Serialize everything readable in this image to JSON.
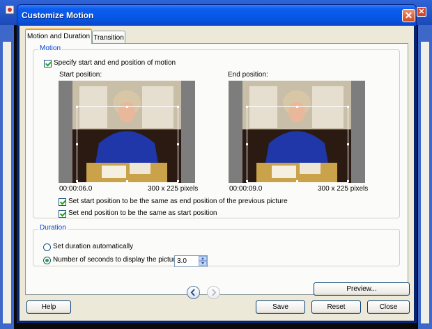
{
  "dialog": {
    "title": "Customize Motion",
    "close_glyph": "✕"
  },
  "tabs": [
    {
      "label": "Motion and Duration",
      "selected": true
    },
    {
      "label": "Transition",
      "selected": false
    }
  ],
  "motion": {
    "group_label": "Motion",
    "specify_checkbox": {
      "label": "Specify start and end position of motion",
      "checked": true
    },
    "start": {
      "label": "Start position:",
      "time": "00:00:06.0",
      "size": "300 x 225 pixels"
    },
    "end": {
      "label": "End position:",
      "time": "00:00:09.0",
      "size": "300 x 225 pixels"
    },
    "same_as_prev_checkbox": {
      "label": "Set start position to be the same as end position of the previous picture",
      "checked": true
    },
    "same_end_checkbox": {
      "label": "Set end position to be the same as start position",
      "checked": true
    }
  },
  "duration": {
    "group_label": "Duration",
    "auto_radio": {
      "label": "Set duration automatically",
      "selected": false
    },
    "seconds_radio": {
      "label": "Number of seconds to display the picture",
      "selected": true
    },
    "seconds_value": "3.0"
  },
  "buttons": {
    "preview": "Preview...",
    "help": "Help",
    "save": "Save",
    "reset": "Reset",
    "close": "Close"
  },
  "icons": {
    "back": "chevron-left-icon",
    "forward": "chevron-right-icon"
  },
  "colors": {
    "titlebar": "#0655e3",
    "accent_tab": "#ff9a00",
    "group_label": "#0046d5",
    "check": "#21a121"
  }
}
